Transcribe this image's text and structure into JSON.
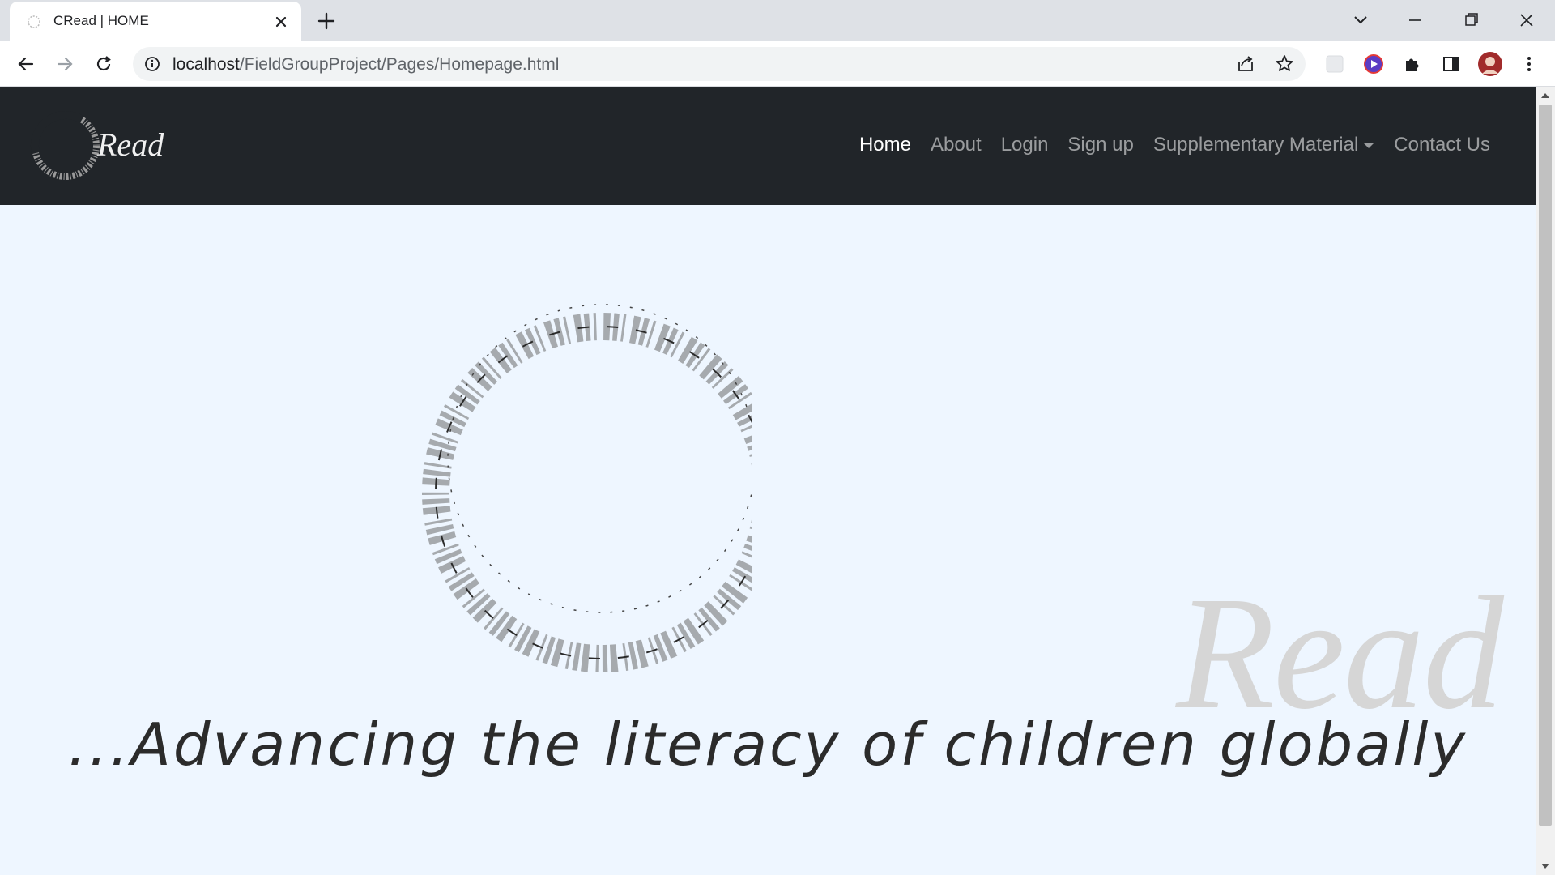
{
  "browser": {
    "tab": {
      "title": "CRead | HOME"
    },
    "address": {
      "host": "localhost",
      "path": "/FieldGroupProject/Pages/Homepage.html"
    }
  },
  "navbar": {
    "brand_text": "Read",
    "links": [
      {
        "label": "Home",
        "active": true
      },
      {
        "label": "About",
        "active": false
      },
      {
        "label": "Login",
        "active": false
      },
      {
        "label": "Sign up",
        "active": false
      },
      {
        "label": "Supplementary Material",
        "active": false,
        "dropdown": true
      },
      {
        "label": "Contact Us",
        "active": false
      }
    ]
  },
  "hero": {
    "logo_text": "Read",
    "tagline": "...Advancing the literacy of children globally"
  },
  "colors": {
    "navbar_bg": "#212529",
    "page_bg": "#eef6ff",
    "hero_logo_text": "#d6d6d6"
  }
}
